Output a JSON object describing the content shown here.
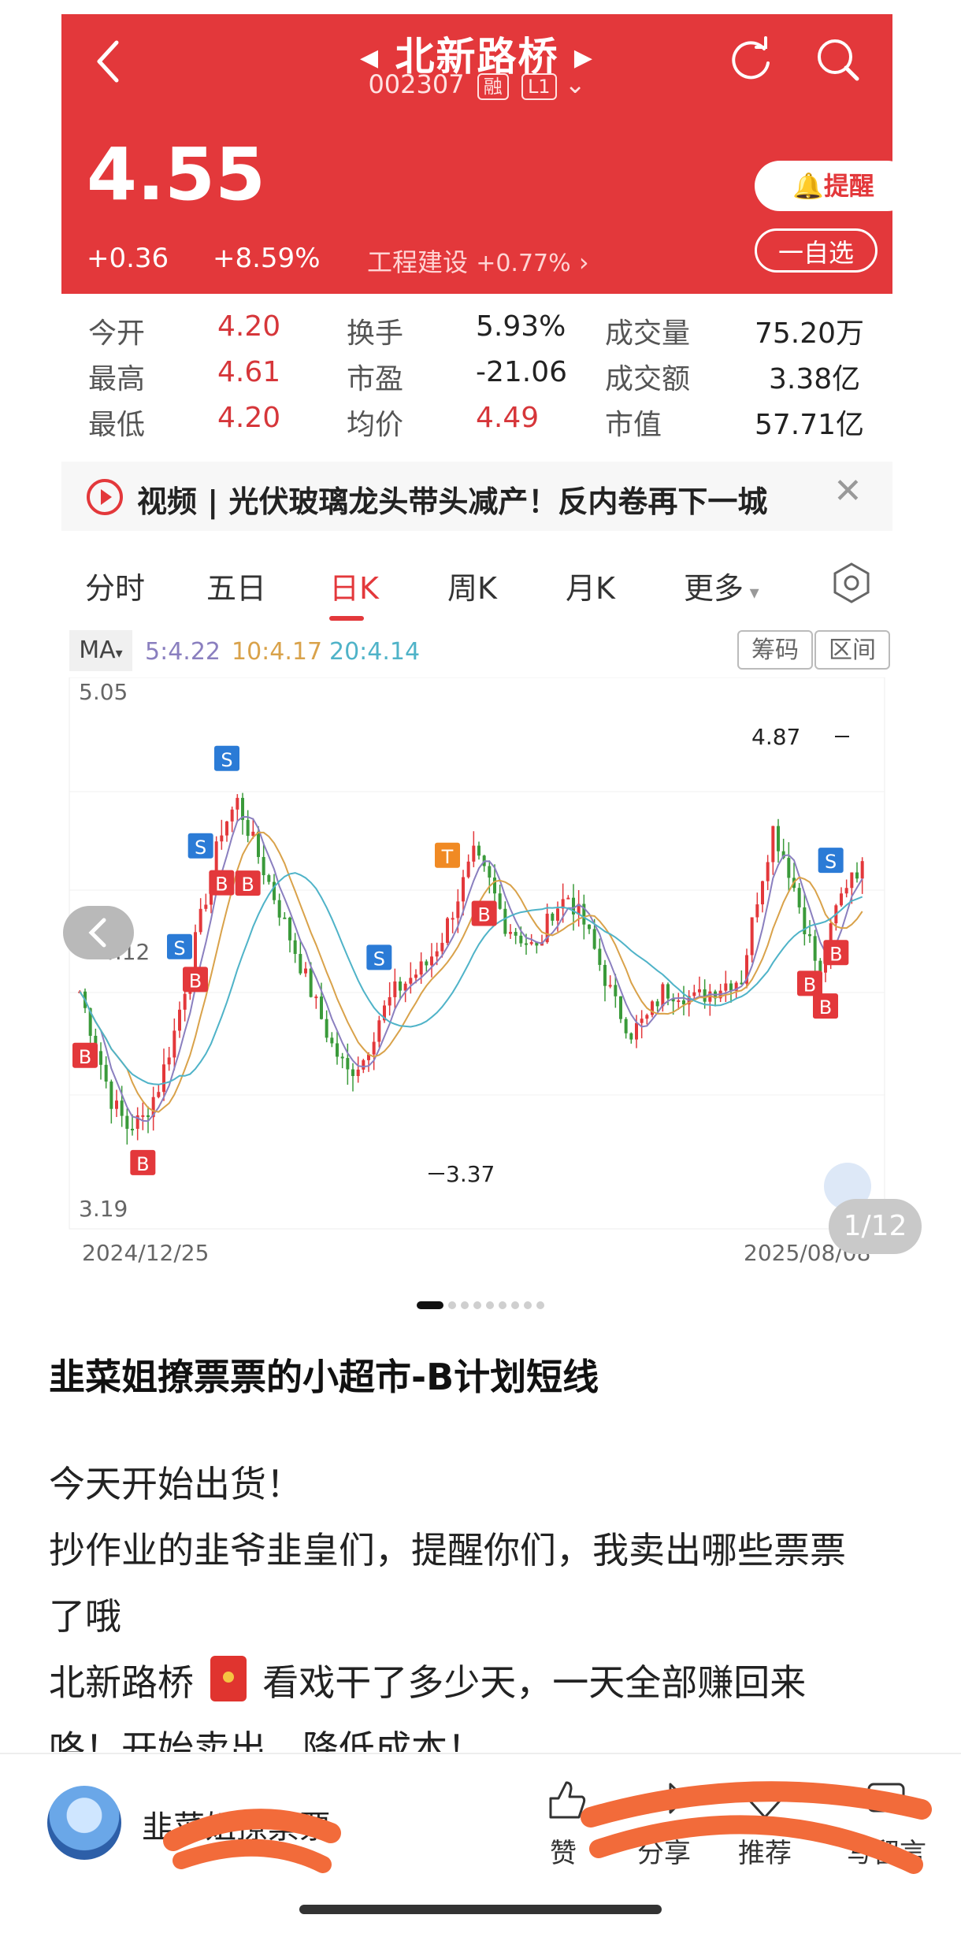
{
  "header": {
    "stock_name": "北新路桥",
    "stock_code": "002307",
    "market_tag": "融",
    "level_tag": "L1",
    "price": "4.55",
    "change_abs": "+0.36",
    "change_pct": "+8.59%",
    "sector_name": "工程建设",
    "sector_pct": "+0.77%",
    "remind_label": "提醒",
    "watch_label": "一自选",
    "colors": {
      "up": "#e3383b",
      "header_bg": "#e3383b"
    }
  },
  "quote": {
    "rows": [
      [
        {
          "label": "今开",
          "value": "4.20"
        },
        {
          "label": "换手",
          "value": "5.93%"
        },
        {
          "label": "成交量",
          "value": "75.20万"
        }
      ],
      [
        {
          "label": "最高",
          "value": "4.61"
        },
        {
          "label": "市盈",
          "value": "-21.06"
        },
        {
          "label": "成交额",
          "value": "3.38亿"
        }
      ],
      [
        {
          "label": "最低",
          "value": "4.20"
        },
        {
          "label": "均价",
          "value": "4.49"
        },
        {
          "label": "市值",
          "value": "57.71亿"
        }
      ]
    ]
  },
  "news": {
    "text": "视频 | 光伏玻璃龙头带头减产！反内卷再下一城"
  },
  "tabs": [
    "分时",
    "五日",
    "日K",
    "周K",
    "月K",
    "更多"
  ],
  "ma": {
    "select_label": "MA",
    "ma5": "5:4.22",
    "ma10": "10:4.17",
    "ma20": "20:4.14",
    "chip_label": "筹码",
    "range_label": "区间"
  },
  "chart_data": {
    "type": "candlestick",
    "x_start": "2024/12/25",
    "x_end": "2025/08/08",
    "y_top_label": "5.05",
    "y_mid_label": "4.12",
    "y_bottom_label": "3.19",
    "ylim": [
      3.19,
      5.05
    ],
    "annotations": {
      "high": "4.87",
      "low": "3.37"
    },
    "close_path": [
      3.95,
      3.75,
      3.55,
      3.45,
      3.48,
      3.6,
      3.8,
      4.05,
      4.3,
      4.55,
      4.65,
      4.5,
      4.35,
      4.2,
      4.05,
      3.9,
      3.75,
      3.65,
      3.7,
      3.85,
      3.95,
      4.0,
      4.05,
      4.15,
      4.3,
      4.45,
      4.35,
      4.2,
      4.15,
      4.1,
      4.25,
      4.3,
      4.2,
      4.05,
      3.9,
      3.8,
      3.85,
      3.95,
      3.95,
      3.92,
      3.95,
      3.98,
      4.0,
      4.3,
      4.55,
      4.4,
      4.2,
      4.0,
      4.25,
      4.4
    ],
    "ma_colors": {
      "ma5": "#8a7fbf",
      "ma10": "#d9a24a",
      "ma20": "#4fb3c8"
    },
    "signals": [
      "B",
      "B",
      "S",
      "S",
      "B",
      "B",
      "S",
      "B",
      "S",
      "T",
      "B",
      "S",
      "B",
      "B",
      "B"
    ]
  },
  "pager": {
    "label": "1/12",
    "dot_count": 9
  },
  "post": {
    "title": "韭菜姐撩票票的小超市-B计划短线",
    "line1": "今天开始出货！",
    "line2": "抄作业的韭爷韭皇们，提醒你们，我卖出哪些票票",
    "line3": "了哦",
    "line4a": "北新路桥",
    "line4b": "看戏干了多少天，一天全部赚回来",
    "line5": "咯！开始卖出，降低成本！"
  },
  "bottom": {
    "author": "韭菜姐撩票票",
    "like": "赞",
    "share": "分享",
    "recommend": "推荐",
    "comment": "写留言"
  }
}
